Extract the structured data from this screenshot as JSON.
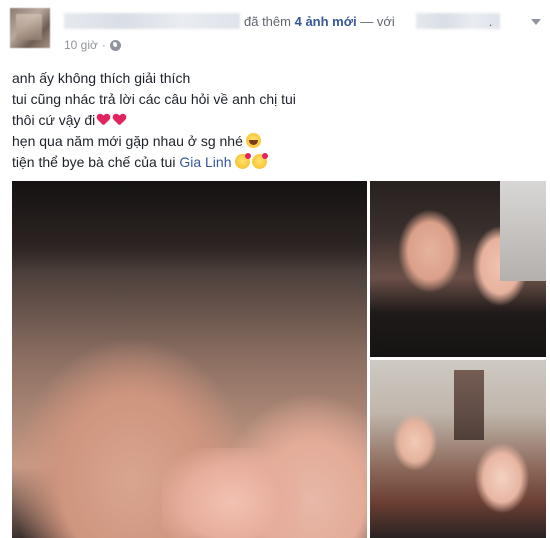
{
  "post": {
    "header": {
      "action_text": "đã thêm",
      "photo_count_link": "4 ảnh mới",
      "with_text": "— với",
      "trailing": "."
    },
    "meta": {
      "time": "10 giờ",
      "separator": "·",
      "privacy_icon": "globe-icon"
    },
    "lines": [
      "anh ấy không thích giải thích",
      "tui cũng nhác trả lời các câu hỏi về anh chị tui",
      "thôi cứ vậy đi",
      "hẹn qua năm mới gặp nhau ở sg nhé",
      "tiện thể bye bà chế của tui"
    ],
    "tagged_name": "Gia Linh"
  },
  "colors": {
    "link": "#365899",
    "muted": "#616770",
    "meta": "#90949c",
    "heart": "#e0245e"
  }
}
